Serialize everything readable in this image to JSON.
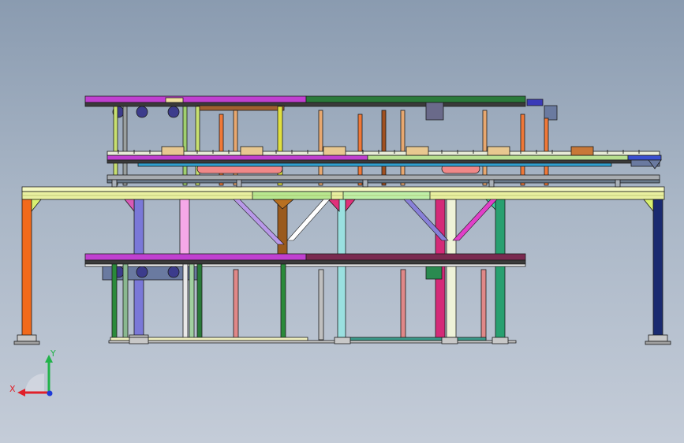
{
  "scene": {
    "background_top": "#8a9bb0",
    "background_bottom": "#c4ccd8",
    "outline_color": "#1c1c1c"
  },
  "triad": {
    "x_label": "X",
    "y_label": "Y",
    "x_color": "#e0202a",
    "y_color": "#22b34a",
    "z_color": "#1e3ad8"
  }
}
